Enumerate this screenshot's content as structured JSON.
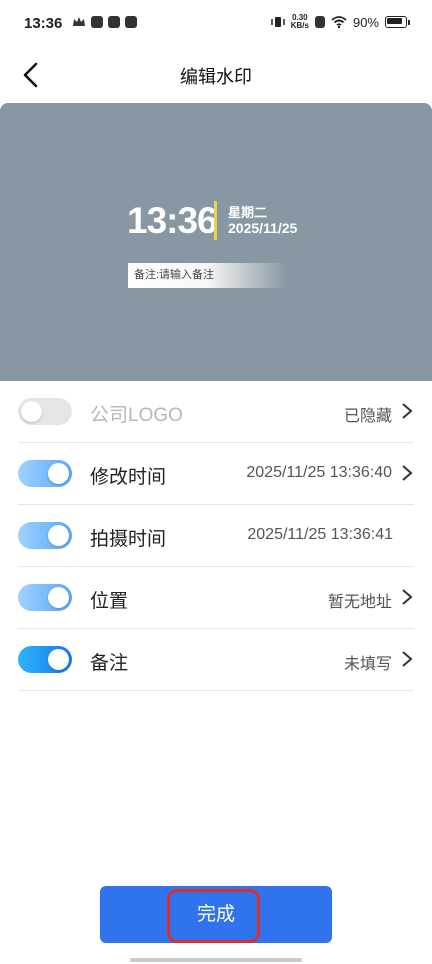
{
  "status_bar": {
    "time": "13:36",
    "net_speed_top": "0.30",
    "net_speed_bottom": "KB/s",
    "battery": "90%"
  },
  "header": {
    "title": "编辑水印",
    "back_icon": "chevron-left-icon"
  },
  "preview": {
    "time": "13:36",
    "weekday": "星期二",
    "date": "2025/11/25",
    "note": "备注:请输入备注",
    "colors": {
      "background": "#8898a3",
      "accent_bar": "#f0d24a"
    }
  },
  "settings": [
    {
      "label": "公司LOGO",
      "value": "已隐藏",
      "enabled": false,
      "arrow": true
    },
    {
      "label": "修改时间",
      "value": "2025/11/25 13:36:40",
      "enabled": true,
      "arrow": true
    },
    {
      "label": "拍摄时间",
      "value": "2025/11/25 13:36:41",
      "enabled": true,
      "arrow": false
    },
    {
      "label": "位置",
      "value": "暂无地址",
      "enabled": true,
      "arrow": true
    },
    {
      "label": "备注",
      "value": "未填写",
      "enabled": true,
      "arrow": true
    }
  ],
  "done_button": {
    "label": "完成",
    "color": "#2f74ee"
  }
}
